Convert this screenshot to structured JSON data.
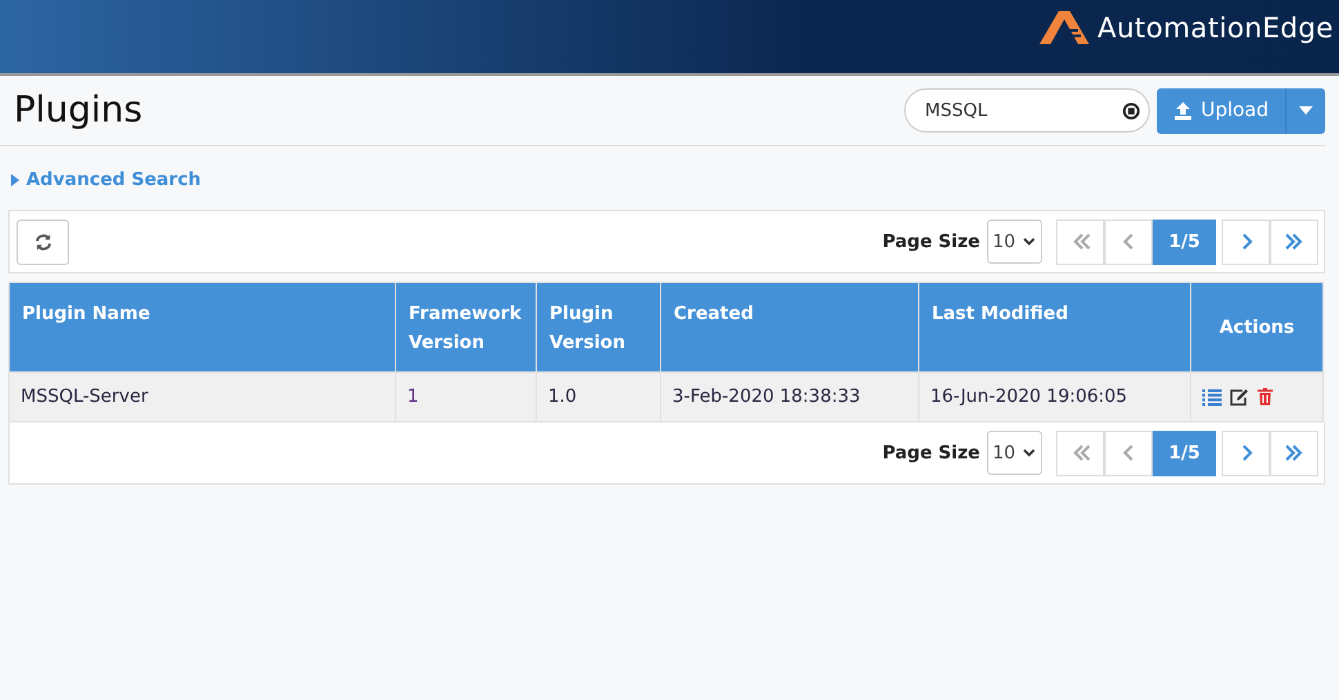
{
  "header": {
    "logo_text": "AutomationEdge"
  },
  "page": {
    "title": "Plugins"
  },
  "search": {
    "value": "MSSQL"
  },
  "upload_button": {
    "label": "Upload"
  },
  "advanced_search": {
    "label": "Advanced Search",
    "expanded": false
  },
  "toolbar_top": {
    "page_size_label": "Page Size",
    "page_size": "10",
    "current": "1/5",
    "nav": [
      {
        "kind": "first",
        "disabled": true
      },
      {
        "kind": "prev",
        "disabled": true
      },
      {
        "kind": "next",
        "disabled": false
      },
      {
        "kind": "last",
        "disabled": false
      }
    ]
  },
  "table": {
    "columns": [
      "Plugin Name",
      "Framework Version",
      "Plugin Version",
      "Created",
      "Last Modified",
      "Actions"
    ],
    "rows": [
      {
        "cells": [
          "MSSQL-Server",
          "1",
          "1.0",
          "3-Feb-2020 18:38:33",
          "16-Jun-2020 19:06:05"
        ],
        "actions": [
          {
            "kind": "list"
          },
          {
            "kind": "edit"
          },
          {
            "kind": "delete"
          }
        ]
      }
    ]
  },
  "toolbar_bottom": {
    "page_size_label": "Page Size",
    "page_size": "10",
    "current": "1/5",
    "nav": [
      {
        "kind": "first",
        "disabled": true
      },
      {
        "kind": "prev",
        "disabled": true
      },
      {
        "kind": "next",
        "disabled": false
      },
      {
        "kind": "last",
        "disabled": false
      }
    ]
  }
}
